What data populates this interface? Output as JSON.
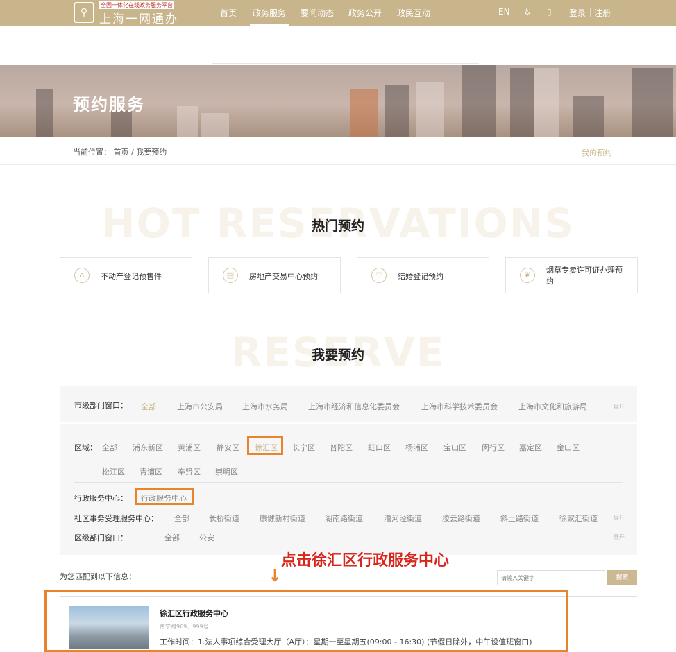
{
  "header": {
    "logo_sub": "全国一体化在线政务服务平台",
    "logo_main": "上海一网通办",
    "nav": [
      "首页",
      "政务服务",
      "要闻动态",
      "政务公开",
      "政民互动"
    ],
    "lang": "EN",
    "login": "登录",
    "register": "注册"
  },
  "banner": {
    "title": "预约服务"
  },
  "breadcrumb": {
    "prefix": "当前位置：",
    "home": "首页",
    "sep": "/",
    "current": "我要预约",
    "my_reservations": "我的预约"
  },
  "hot": {
    "watermark": "HOT RESERVATIONS",
    "title": "热门预约",
    "cards": [
      {
        "label": "不动产登记预售件",
        "icon": "house-icon"
      },
      {
        "label": "房地产交易中心预约",
        "icon": "document-icon"
      },
      {
        "label": "结婚登记预约",
        "icon": "heart-icon"
      },
      {
        "label": "烟草专卖许可证办理预约",
        "icon": "leaf-icon"
      }
    ]
  },
  "reserve": {
    "watermark": "RESERVE",
    "title": "我要预约"
  },
  "filters": {
    "city_label": "市级部门窗口：",
    "city": [
      "全部",
      "上海市公安局",
      "上海市水务局",
      "上海市经济和信息化委员会",
      "上海市科学技术委员会",
      "上海市文化和旅游局"
    ],
    "expand": "展开",
    "region_label": "区域：",
    "regions": [
      "全部",
      "浦东新区",
      "黄浦区",
      "静安区",
      "徐汇区",
      "长宁区",
      "普陀区",
      "虹口区",
      "杨浦区",
      "宝山区",
      "闵行区",
      "嘉定区",
      "金山区",
      "松江区",
      "青浦区",
      "奉贤区",
      "崇明区"
    ],
    "admin_label": "行政服务中心：",
    "admin": [
      "行政服务中心"
    ],
    "community_label": "社区事务受理服务中心：",
    "community": [
      "全部",
      "长桥街道",
      "康健新村街道",
      "湖南路街道",
      "漕河泾街道",
      "凌云路街道",
      "斜土路街道",
      "徐家汇街道"
    ],
    "district_label": "区级部门窗口：",
    "district": [
      "全部",
      "公安"
    ]
  },
  "annotation": "点击徐汇区行政服务中心",
  "results": {
    "label": "为您匹配到以下信息：",
    "search_placeholder": "请输入关键字",
    "search_button": "搜索",
    "items": [
      {
        "title": "徐汇区行政服务中心",
        "address": "南宁路969、999号",
        "hours": "工作时间：1.法人事项综合受理大厅（A厅）：星期一至星期五(09:00 - 16:30) (节假日除外，中午设值班窗口)"
      }
    ]
  },
  "colors": {
    "gold": "#c8b58c",
    "annotation": "#d9261c",
    "highlight": "#e8842b"
  }
}
